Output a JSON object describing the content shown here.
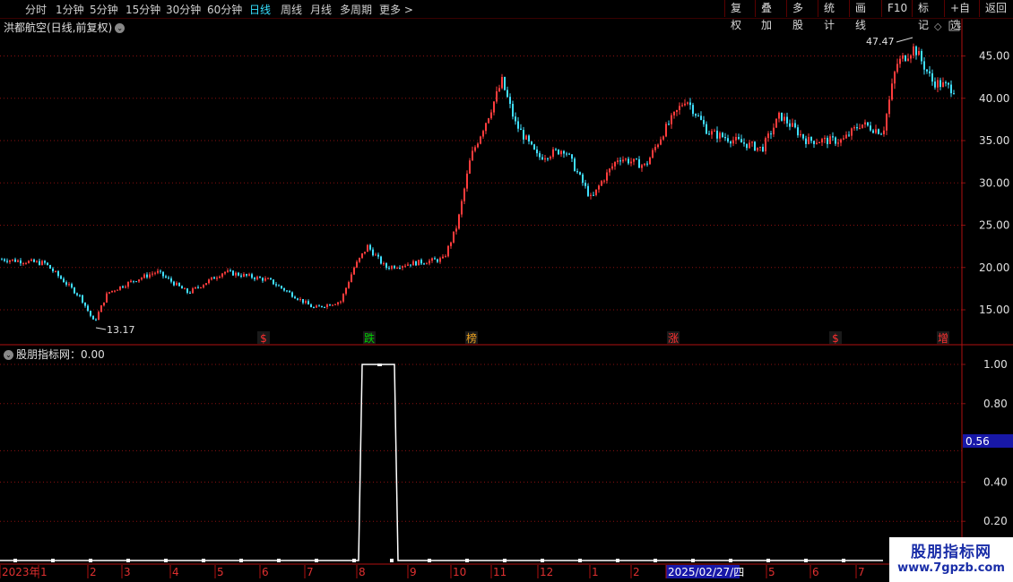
{
  "toolbar": {
    "periods": [
      "分时",
      "1分钟",
      "5分钟",
      "15分钟",
      "30分钟",
      "60分钟",
      "日线",
      "周线",
      "月线",
      "多周期",
      "更多 >"
    ],
    "active_period": "日线",
    "actions": [
      "复权",
      "叠加",
      "多股",
      "统计",
      "画线",
      "F10",
      "标记",
      "+自选",
      "返回"
    ]
  },
  "price_panel": {
    "title": "洪都航空(日线,前复权)",
    "high_label": "47.47",
    "low_label": "13.17",
    "axis_ticks": [
      "45.00",
      "40.00",
      "35.00",
      "30.00",
      "25.00",
      "20.00",
      "15.00"
    ],
    "markers": [
      {
        "text": "$",
        "color": "#ff3030"
      },
      {
        "text": "跌",
        "color": "#00d000"
      },
      {
        "text": "榜",
        "color": "#e8a020"
      },
      {
        "text": "涨",
        "color": "#ff3030"
      },
      {
        "text": "$",
        "color": "#ff3030"
      },
      {
        "text": "增",
        "color": "#ff3030"
      }
    ]
  },
  "indicator_panel": {
    "title": "股朋指标网：0.00",
    "axis_ticks": [
      "1.00",
      "0.80",
      "0.40",
      "0.20"
    ],
    "highlight_value": "0.56"
  },
  "time_axis": {
    "labels": [
      "2023年",
      "1",
      "2",
      "3",
      "4",
      "5",
      "6",
      "7",
      "8",
      "9",
      "10",
      "11",
      "12",
      "1",
      "2",
      "2025/02/27/四",
      "5",
      "6",
      "7"
    ],
    "highlight": "2025/02/27/四"
  },
  "watermark": {
    "line1": "股朋指标网",
    "line2": "www.7gpzb.com"
  },
  "colors": {
    "up": "#ff3c3c",
    "down": "#40e0ff",
    "grid": "#8a1010",
    "axis_text": "#e0e0e0",
    "active": "#35e0ff",
    "highlight_bg": "#1818a8"
  }
}
